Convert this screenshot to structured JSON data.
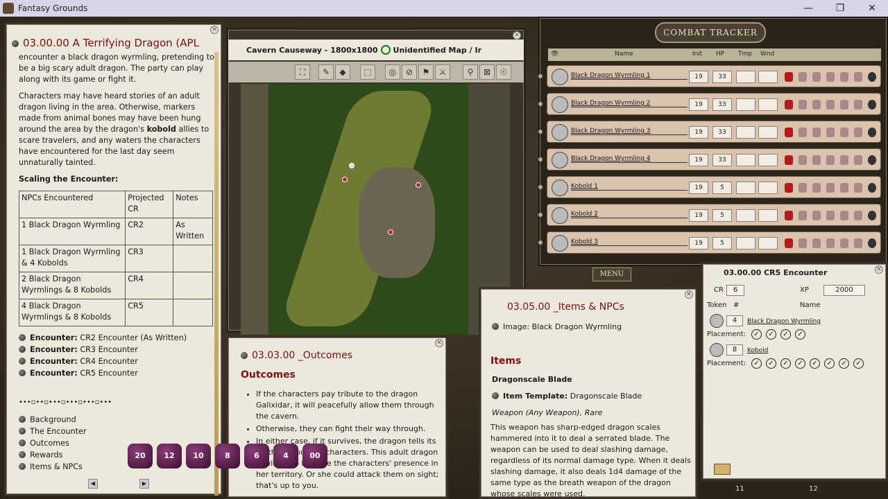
{
  "app": {
    "title": "Fantasy Grounds"
  },
  "window_controls": {
    "minimize": "—",
    "maximize": "❐",
    "close": "✕"
  },
  "story": {
    "title": "03.00.00 A Terrifying Dragon (APL",
    "paragraph1": "encounter a black dragon wyrmling, pretending to be a big scary adult dragon. The party can play along with its game or fight it.",
    "paragraph2_pre": "Characters may have heard stories of an adult dragon living in the area. Otherwise, markers made from animal bones may have been hung around the area by the dragon's ",
    "paragraph2_bold": "kobold",
    "paragraph2_post": " allies to scare travelers, and any waters the characters have encountered for the last day seem unnaturally tainted.",
    "scaling_title": "Scaling the Encounter:",
    "table": {
      "headers": [
        "NPCs Encountered",
        "Projected CR",
        "Notes"
      ],
      "rows": [
        [
          "1 Black Dragon Wyrmling",
          "CR2",
          "As Written"
        ],
        [
          "1 Black Dragon Wyrmling & 4 Kobolds",
          "CR3",
          ""
        ],
        [
          "2 Black Dragon Wyrmlings & 8 Kobolds",
          "CR4",
          ""
        ],
        [
          "4 Black Dragon Wyrmlings & 8 Kobolds",
          "CR5",
          ""
        ]
      ]
    },
    "encounters": [
      {
        "label": "Encounter:",
        "value": "CR2 Encounter (As Written)"
      },
      {
        "label": "Encounter:",
        "value": "CR3 Encounter"
      },
      {
        "label": "Encounter:",
        "value": "CR4 Encounter"
      },
      {
        "label": "Encounter:",
        "value": "CR5 Encounter"
      }
    ],
    "divider": "•••▫••▫•••▫•••▫•••▫•••",
    "toc": [
      "Background",
      "The Encounter",
      "Outcomes",
      "Rewards",
      "Items & NPCs"
    ],
    "prev": "◀",
    "next": "▶"
  },
  "map_window": {
    "title": "Cavern Causeway - 1800x1800",
    "id_label": "ID",
    "subtitle": "Unidentified Map / Ir"
  },
  "combat_tracker": {
    "title": "COMBAT TRACKER",
    "columns": {
      "name": "Name",
      "init": "Init",
      "hp": "HP",
      "tmp": "Tmp",
      "wnd": "Wnd"
    },
    "rows": [
      {
        "name": "Black Dragon Wyrmling 1",
        "init": "19",
        "hp": "33"
      },
      {
        "name": "Black Dragon Wyrmling 2",
        "init": "19",
        "hp": "33"
      },
      {
        "name": "Black Dragon Wyrmling 3",
        "init": "19",
        "hp": "33"
      },
      {
        "name": "Black Dragon Wyrmling 4",
        "init": "19",
        "hp": "33"
      },
      {
        "name": "Kobold 1",
        "init": "19",
        "hp": "5"
      },
      {
        "name": "Kobold 2",
        "init": "19",
        "hp": "5"
      },
      {
        "name": "Kobold 3",
        "init": "19",
        "hp": "5"
      }
    ],
    "menu_label": "MENU"
  },
  "outcomes": {
    "title": "03.03.00 _Outcomes",
    "heading": "Outcomes",
    "bullets": [
      "If the characters pay tribute to the dragon Galixidar, it will peacefully allow them through the cavern.",
      "Otherwise, they can fight their way through.",
      "In either case, if it survives, the dragon tells its mother about the characters. This adult dragon is willing to tolerate the characters' presence in her territory. Or she could attack them on sight; that's up to you."
    ]
  },
  "items": {
    "title": "03.05.00 _Items & NPCs",
    "image_line": "Image: Black Dragon Wyrmling",
    "heading": "Items",
    "item_name": "Dragonscale Blade",
    "template_label": "Item Template:",
    "template_value": "Dragonscale Blade",
    "weapon_type": "Weapon (Any Weapon), Rare",
    "description": "This weapon has sharp-edged dragon scales hammered into it to deal a serrated blade. The weapon can be used to deal slashing damage, regardless of its normal damage type. When it deals slashing damage, it also deals 1d4 damage of the same type as the breath weapon of the dragon whose scales were used."
  },
  "encounter": {
    "title": "03.00.00 CR5 Encounter",
    "cr_label": "CR",
    "cr_value": "6",
    "xp_label": "XP",
    "xp_value": "2000",
    "token_label": "Token",
    "count_label": "#",
    "name_label": "Name",
    "placement_label": "Placement:",
    "npcs": [
      {
        "count": "4",
        "name": "Black Dragon Wyrmling",
        "placements": 4
      },
      {
        "count": "8",
        "name": "Kobold",
        "placements": 8
      }
    ]
  },
  "dice": [
    "20",
    "12",
    "10",
    "8",
    "6",
    "4",
    "00"
  ],
  "hotkeys": {
    "k11": "11",
    "k12": "12"
  }
}
